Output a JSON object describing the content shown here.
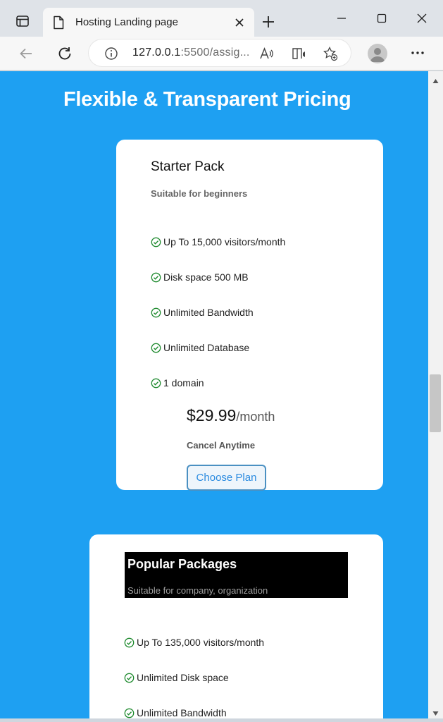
{
  "browser": {
    "tab_title": "Hosting Landing page",
    "url_host": "127.0.0.1",
    "url_rest": ":5500/assig..."
  },
  "page": {
    "heading": "Flexible & Transparent Pricing",
    "accent_color": "#1ea0f2",
    "check_color": "#1e8a2e",
    "plans": [
      {
        "title": "Starter Pack",
        "subtitle": "Suitable for beginners",
        "features": [
          "Up To 15,000 visitors/month",
          "Disk space 500 MB",
          "Unlimited Bandwidth",
          "Unlimited Database",
          "1 domain"
        ],
        "price": "$29.99",
        "period": "/month",
        "note": "Cancel Anytime",
        "button_label": "Choose Plan"
      },
      {
        "title": "Popular Packages",
        "subtitle": "Suitable for company, organization",
        "features": [
          "Up To 135,000 visitors/month",
          "Unlimited Disk space",
          "Unlimited Bandwidth"
        ]
      }
    ]
  }
}
